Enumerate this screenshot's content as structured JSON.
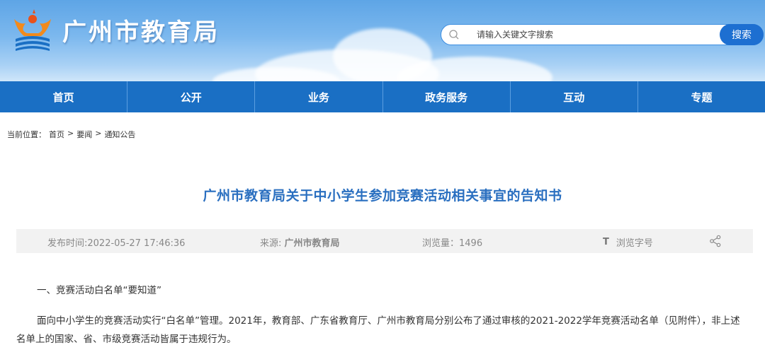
{
  "header": {
    "site_title": "广州市教育局",
    "search_placeholder": "请输入关键文字搜索",
    "search_button": "搜索",
    "logo_icon": "guangzhou-education-logo-icon",
    "colors": {
      "nav": "#1a6fc4",
      "title": "#2a6fc0",
      "search_button": "#1d6fd1"
    }
  },
  "nav": {
    "items": [
      "首页",
      "公开",
      "业务",
      "政务服务",
      "互动",
      "专题"
    ]
  },
  "breadcrumb": {
    "prefix": "当前位置：",
    "items": [
      "首页",
      "要闻",
      "通知公告"
    ],
    "separator": ">"
  },
  "article": {
    "title": "广州市教育局关于中小学生参加竞赛活动相关事宜的告知书",
    "meta": {
      "date": "发布时间:2022-05-27 17:46:36",
      "source_label": "来源: ",
      "source": "广州市教育局",
      "views": "浏览量：1496",
      "font_icon": "T",
      "font_label": "浏览字号",
      "share_icon": "share-icon"
    },
    "paragraphs": [
      "一、竞赛活动白名单“要知道”",
      "面向中小学生的竞赛活动实行“白名单”管理。2021年，教育部、广东省教育厅、广州市教育局分别公布了通过审核的2021-2022学年竞赛活动名单（见附件），非上述名单上的国家、省、市级竞赛活动皆属于违规行为。"
    ]
  }
}
